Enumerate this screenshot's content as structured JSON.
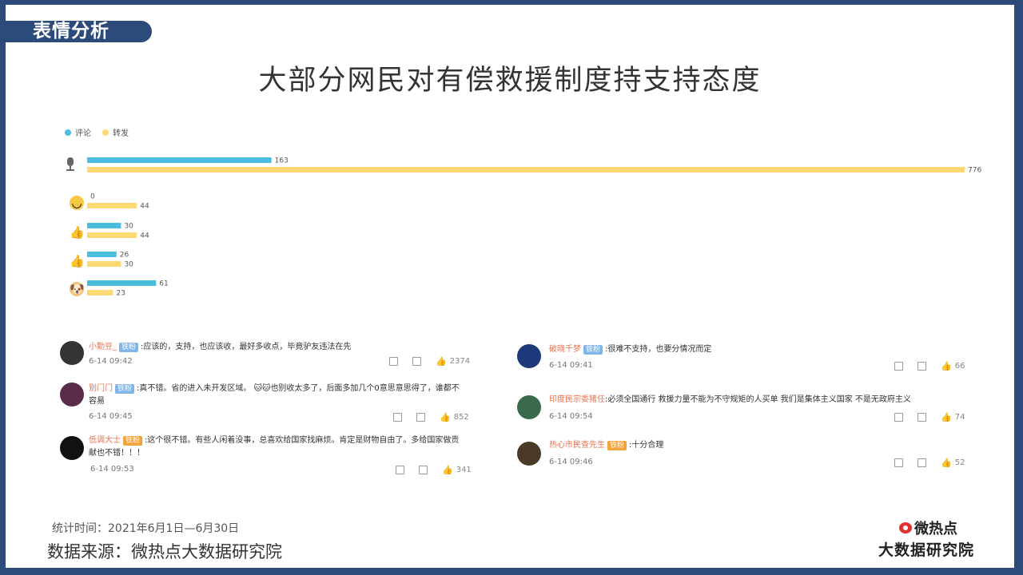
{
  "section_tab": "表情分析",
  "headline": "大部分网民对有偿救援制度持支持态度",
  "chart_data": {
    "type": "bar",
    "orientation": "horizontal",
    "categories": [
      "microphone-icon",
      "smile-icon",
      "thumbs-up-icon",
      "thumbs-up-alt-icon",
      "doge-icon"
    ],
    "series": [
      {
        "name": "评论",
        "color": "#4bbedf",
        "values": [
          163,
          0,
          30,
          26,
          61
        ]
      },
      {
        "name": "转发",
        "color": "#fcd973",
        "values": [
          776,
          44,
          44,
          30,
          23
        ]
      }
    ],
    "xlim": [
      0,
      776
    ],
    "grid": false,
    "legend": "top-left"
  },
  "comments_left": [
    {
      "user": "小勤豆_",
      "badge": "铁粉",
      "text": ":应该的，支持，也应该收，最好多收点，毕竟驴友违法在先",
      "time": "6-14 09:42",
      "likes": "2374"
    },
    {
      "user": "别门门",
      "badge": "铁粉",
      "text": ":真不错。省的进入未开发区域。",
      "text2": "也别收太多了，后面多加几个0意思意思得了，谁都不容易",
      "time": "6-14 09:45",
      "likes": "852"
    },
    {
      "user": "低调大士",
      "badge": "铁粉",
      "text": ":这个很不错。有些人闲着没事，总喜欢给国家找麻烦。肯定是财物自由了。多给国家做贡献也不错！！！",
      "time": "6-14 09:53",
      "likes": "341"
    }
  ],
  "comments_right": [
    {
      "user": "破晓千梦",
      "badge": "铁粉",
      "text": ":很难不支持，也要分情况而定",
      "time": "6-14 09:41",
      "likes": "66"
    },
    {
      "user": "印度民宗委猪任",
      "text": ":必须全国通行 救援力量不能为不守规矩的人买单 我们是集体主义国家 不是无政府主义",
      "time": "6-14 09:54",
      "likes": "74"
    },
    {
      "user": "热心市民查先生",
      "badge": "铁粉",
      "text": ":十分合理",
      "time": "6-14 09:46",
      "likes": "52"
    }
  ],
  "footnote_period": "统计时间：2021年6月1日—6月30日",
  "footnote_source": "数据来源：微热点大数据研究院",
  "logo_top": "微热点",
  "logo_bottom": "大数据研究院"
}
